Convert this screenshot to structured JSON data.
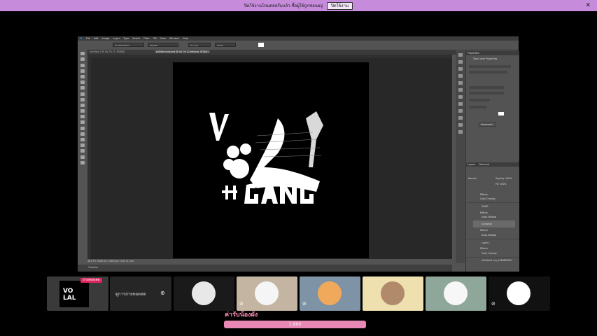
{
  "banner": {
    "message": "ปิดใช้งานโหมดสตรีมแล้ว ซื้อผู้ใช้ถูกซ่อนอยู่",
    "button": "ปิดใช้งาน"
  },
  "photoshop": {
    "menu": [
      "Ps",
      "File",
      "Edit",
      "Image",
      "Layer",
      "Type",
      "Select",
      "Filter",
      "3D",
      "View",
      "Window",
      "Help"
    ],
    "options": {
      "font": "Cordset Blood",
      "style": "Regular",
      "size": "67.3 pt",
      "aa": "Sharp"
    },
    "tabs": [
      {
        "label": "Untitled-1 @ 16.7% (T, RGB/8)",
        "active": false
      },
      {
        "label": "ts0t8emlytw.psd @ 46.7% (Cordstyle, RGB/8)",
        "active": true
      }
    ],
    "status": "46.67%   4000 px x 4000 px (118.11 ppi)",
    "timeline": "Timeline",
    "panels": {
      "properties_title": "Properties",
      "properties_sub": "Type Layer Properties",
      "advanced_btn": "Advanced...",
      "layers_tabs": [
        "Layers",
        "Channels"
      ],
      "blend_mode": "Normal",
      "opacity_label": "Opacity: 100%",
      "fill_label": "Fill: 100%",
      "layer_names": [
        "Effects",
        "Color Overlay",
        "GANG",
        "Effects",
        "Drop Shadow",
        "Cordstyle",
        "Effects",
        "Drop Shadow",
        "Layer 1",
        "Effects",
        "Color Overlay",
        "Untitled-1.cra_1546896353"
      ]
    }
  },
  "stream": {
    "live_badge": "ถ่ายทอดสด",
    "watch_live": "ดูการถ่ายทอดสด",
    "goal_label": "ค่ารับน้องผัง",
    "goal_value": "1,900"
  },
  "colors": {
    "banner": "#c78bdc",
    "ps_bg": "#535353",
    "goal": "#e889b5",
    "live": "#e0245e"
  }
}
